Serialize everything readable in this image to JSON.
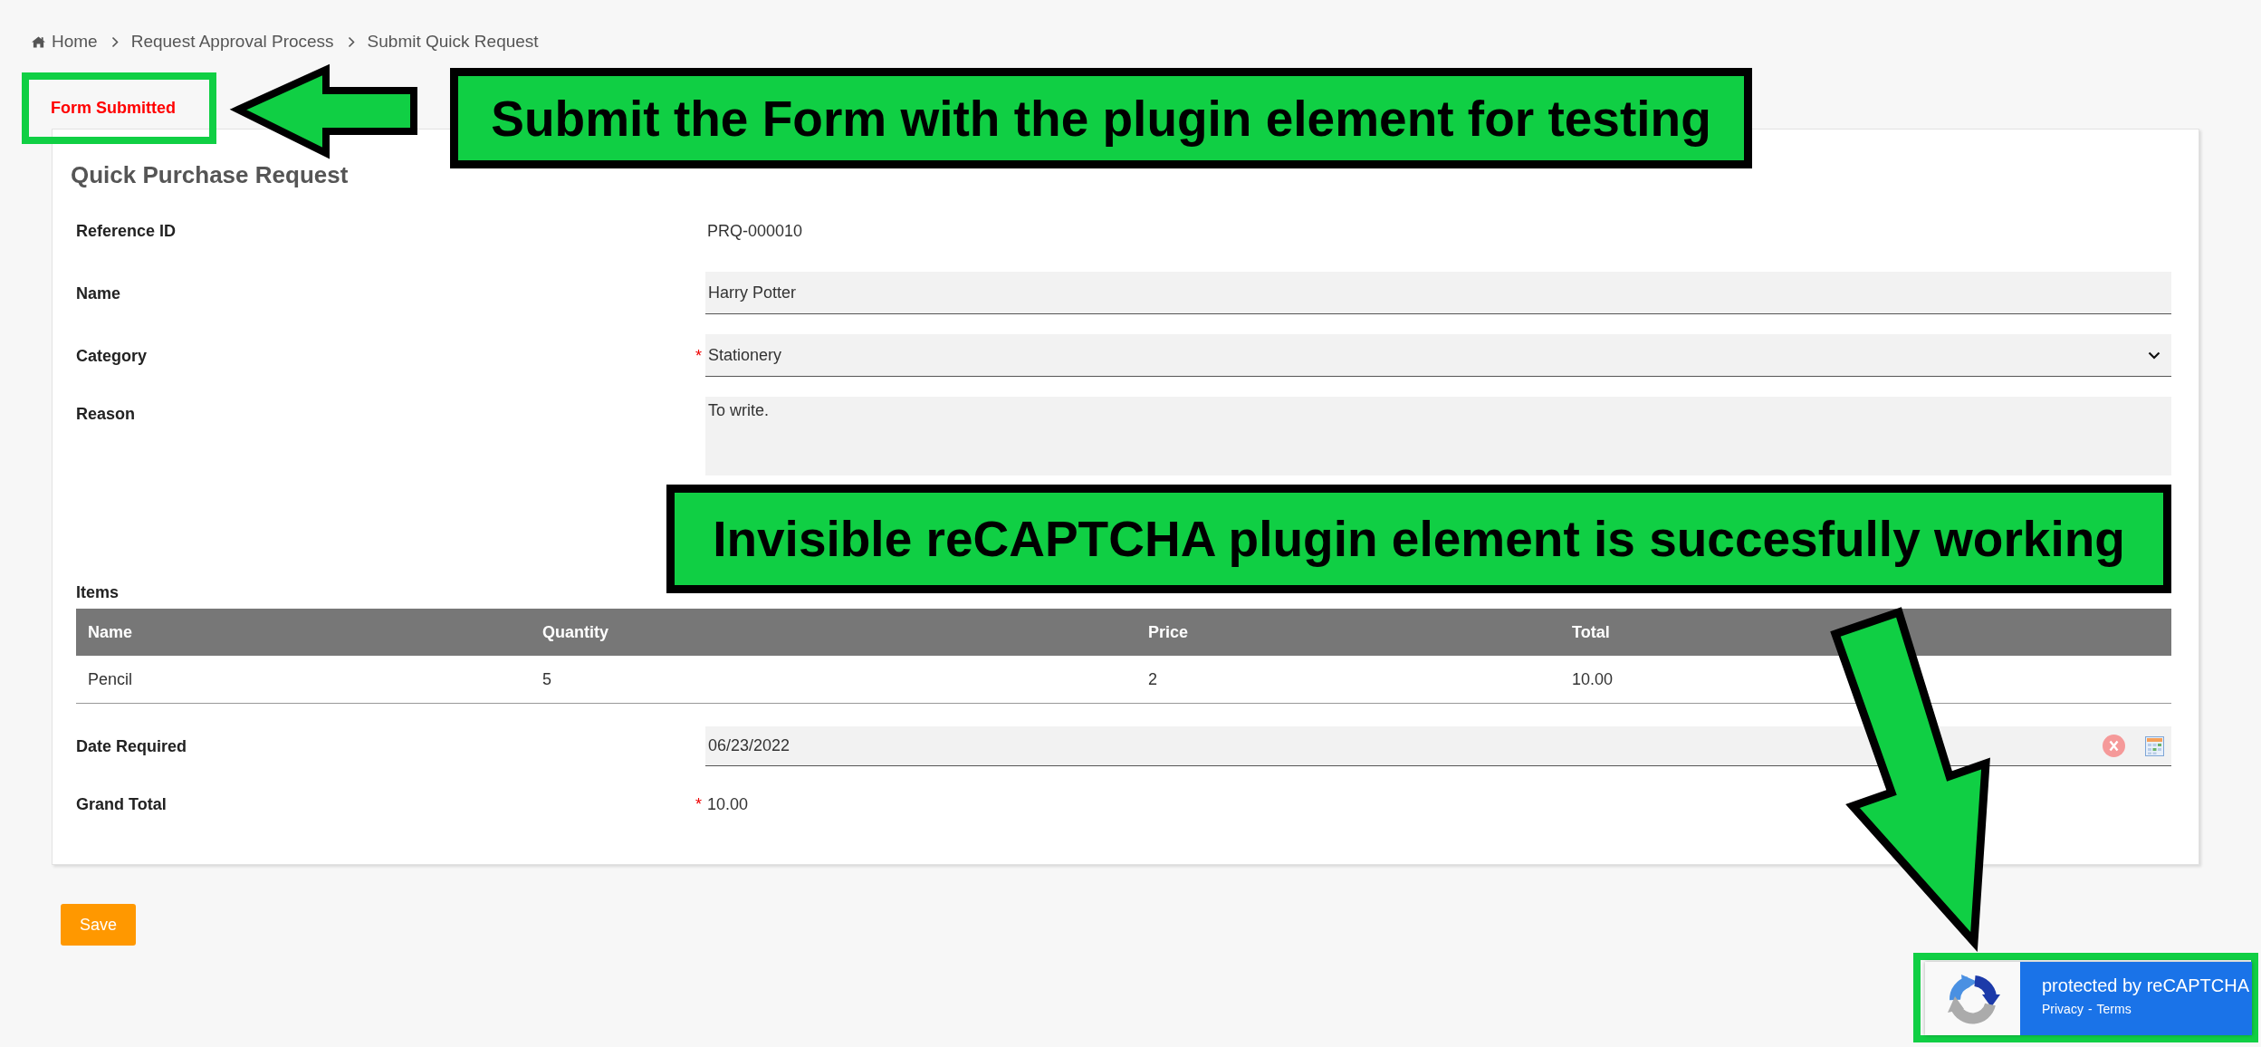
{
  "breadcrumb": [
    {
      "label": "Home",
      "kind": "home"
    },
    {
      "label": "Request Approval Process",
      "kind": "page"
    },
    {
      "label": "Submit Quick Request",
      "kind": "page"
    }
  ],
  "status_message": "Form Submitted",
  "form": {
    "title": "Quick Purchase Request",
    "fields": [
      {
        "kind": "text",
        "label": "Reference ID",
        "value": "PRQ-000010"
      },
      {
        "kind": "input",
        "label": "Name",
        "value": "Harry Potter"
      },
      {
        "kind": "select",
        "label": "Category",
        "required_mark": "*",
        "value": "Stationery"
      },
      {
        "kind": "textarea",
        "label": "Reason",
        "value": "To write."
      },
      {
        "kind": "grid",
        "label": "Items",
        "columns": [
          "Name",
          "Quantity",
          "Price",
          "Total"
        ],
        "rows": [
          [
            "Pencil",
            "5",
            "2",
            "10.00"
          ]
        ]
      },
      {
        "kind": "date",
        "label": "Date Required",
        "value": "06/23/2022"
      },
      {
        "kind": "text",
        "label": "Grand Total",
        "required_mark": "*",
        "value": "10.00"
      }
    ]
  },
  "save_button": "Save",
  "recaptcha_badge": {
    "title": "protected by reCAPTCHA",
    "links": [
      "Privacy",
      "Terms"
    ],
    "separator": "-"
  },
  "annotations": [
    {
      "text": "Submit the Form with the plugin element for testing"
    },
    {
      "text": "Invisible reCAPTCHA plugin element is succesfully working"
    }
  ]
}
